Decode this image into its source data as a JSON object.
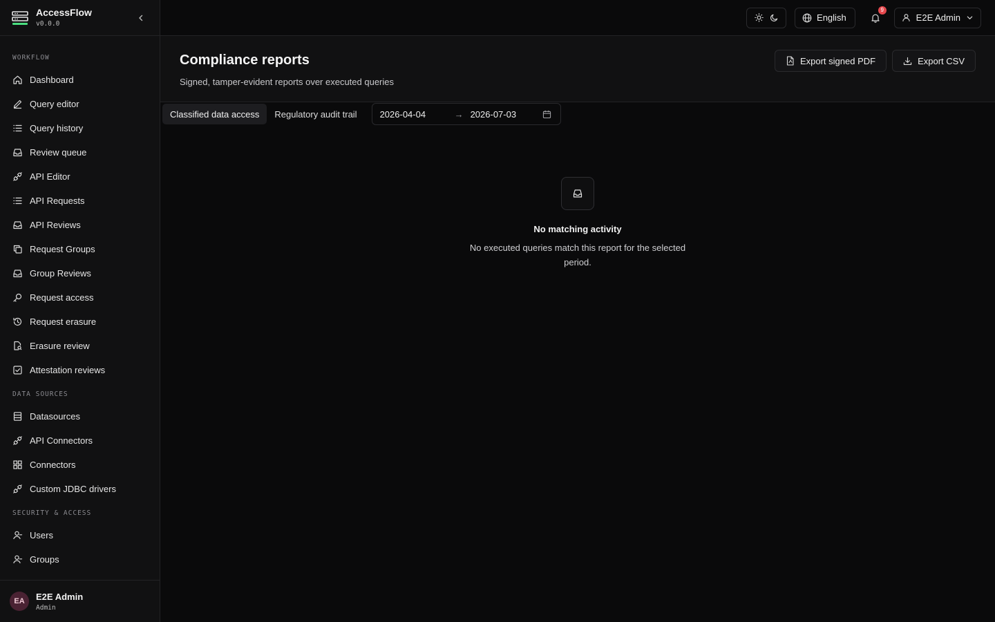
{
  "app": {
    "name": "AccessFlow",
    "version": "v0.0.0"
  },
  "sidebar": {
    "sections": [
      {
        "label": "WORKFLOW",
        "items": [
          {
            "label": "Dashboard",
            "icon": "home-icon"
          },
          {
            "label": "Query editor",
            "icon": "pencil-icon"
          },
          {
            "label": "Query history",
            "icon": "list-icon"
          },
          {
            "label": "Review queue",
            "icon": "inbox-icon"
          },
          {
            "label": "API Editor",
            "icon": "plug-icon"
          },
          {
            "label": "API Requests",
            "icon": "list-icon"
          },
          {
            "label": "API Reviews",
            "icon": "inbox-icon"
          },
          {
            "label": "Request Groups",
            "icon": "copy-icon"
          },
          {
            "label": "Group Reviews",
            "icon": "inbox-icon"
          },
          {
            "label": "Request access",
            "icon": "key-icon"
          },
          {
            "label": "Request erasure",
            "icon": "history-icon"
          },
          {
            "label": "Erasure review",
            "icon": "file-search-icon"
          },
          {
            "label": "Attestation reviews",
            "icon": "check-square-icon"
          }
        ]
      },
      {
        "label": "DATA SOURCES",
        "items": [
          {
            "label": "Datasources",
            "icon": "database-icon"
          },
          {
            "label": "API Connectors",
            "icon": "plug-icon"
          },
          {
            "label": "Connectors",
            "icon": "grid-icon"
          },
          {
            "label": "Custom JDBC drivers",
            "icon": "plug-icon"
          }
        ]
      },
      {
        "label": "SECURITY & ACCESS",
        "items": [
          {
            "label": "Users",
            "icon": "user-icon"
          },
          {
            "label": "Groups",
            "icon": "user-icon"
          }
        ]
      }
    ],
    "user": {
      "initials": "EA",
      "name": "E2E Admin",
      "role": "Admin"
    }
  },
  "topbar": {
    "language": "English",
    "notifications_count": "9",
    "user_label": "E2E Admin"
  },
  "page": {
    "title": "Compliance reports",
    "subtitle": "Signed, tamper-evident reports over executed queries",
    "export_pdf_label": "Export signed PDF",
    "export_csv_label": "Export CSV",
    "tabs": [
      {
        "label": "Classified data access",
        "active": true
      },
      {
        "label": "Regulatory audit trail",
        "active": false
      }
    ],
    "date_range": {
      "start": "2026-04-04",
      "separator": "→",
      "end": "2026-07-03"
    },
    "empty": {
      "title": "No matching activity",
      "description": "No executed queries match this report for the selected period."
    }
  },
  "colors": {
    "background": "#0a0a0b",
    "sidebar": "#111112",
    "border": "#232325",
    "brand_green": "#4ade80",
    "badge_red": "#e5484d"
  }
}
